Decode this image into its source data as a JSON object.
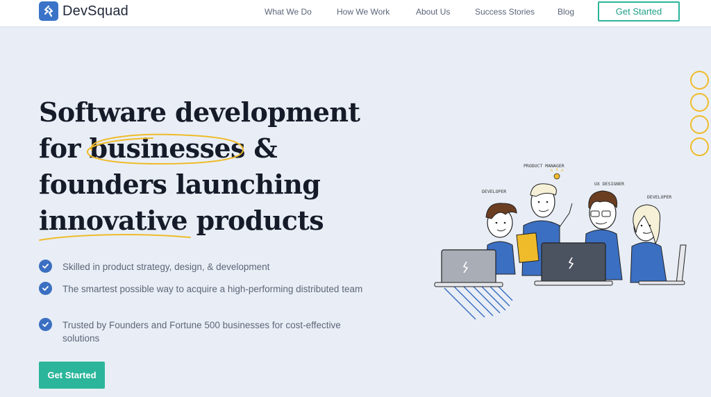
{
  "brand": {
    "name": "DevSquad"
  },
  "nav": {
    "links": [
      "What We Do",
      "How We Work",
      "About Us",
      "Success Stories",
      "Blog"
    ],
    "cta": "Get Started"
  },
  "hero": {
    "title_lines": [
      "Software development",
      "for businesses &",
      "founders launching",
      "innovative products"
    ],
    "features": [
      "Skilled in product strategy, design, & development",
      "The smartest possible way to acquire a high-performing distributed team",
      "Trusted by Founders and Fortune 500 businesses for cost-effective solutions"
    ],
    "cta": "Get Started"
  },
  "illustration": {
    "labels": [
      "PRODUCT MANAGER",
      "DEVELOPER",
      "UX DESIGNER",
      "DEVELOPER"
    ]
  },
  "colors": {
    "accent": "#2bb59a",
    "brand_blue": "#3b6fc1",
    "highlight": "#efbb2a",
    "background": "#e9eef6"
  }
}
